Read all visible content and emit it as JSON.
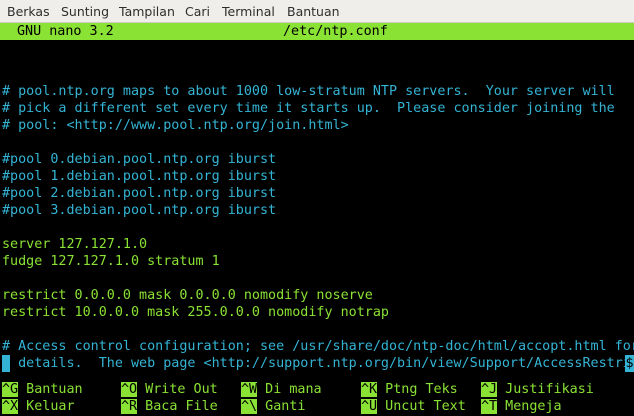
{
  "menubar": {
    "items": [
      "Berkas",
      "Sunting",
      "Tampilan",
      "Cari",
      "Terminal",
      "Bantuan"
    ]
  },
  "nano": {
    "version": "GNU nano 3.2",
    "filename": "/etc/ntp.conf"
  },
  "file_lines": [
    "",
    "",
    "# pool.ntp.org maps to about 1000 low-stratum NTP servers.  Your server will",
    "# pick a different set every time it starts up.  Please consider joining the",
    "# pool: <http://www.pool.ntp.org/join.html>",
    "",
    "#pool 0.debian.pool.ntp.org iburst",
    "#pool 1.debian.pool.ntp.org iburst",
    "#pool 2.debian.pool.ntp.org iburst",
    "#pool 3.debian.pool.ntp.org iburst",
    "",
    "server 127.127.1.0",
    "fudge 127.127.1.0 stratum 1",
    "",
    "restrict 0.0.0.0 mask 0.0.0.0 nomodify noserve",
    "restrict 10.0.0.0 mask 255.0.0.0 nomodify notrap",
    "",
    "# Access control configuration; see /usr/share/doc/ntp-doc/html/accopt.html for",
    "# details.  The web page <http://support.ntp.org/bin/view/Support/AccessRestri"
  ],
  "truncation_marker": "$",
  "shortcuts": [
    {
      "key": "^G",
      "label": "Bantuan"
    },
    {
      "key": "^O",
      "label": "Write Out"
    },
    {
      "key": "^W",
      "label": "Di mana"
    },
    {
      "key": "^K",
      "label": "Ptng Teks"
    },
    {
      "key": "^J",
      "label": "Justifikasi"
    },
    {
      "key": "^X",
      "label": "Keluar"
    },
    {
      "key": "^R",
      "label": "Baca File"
    },
    {
      "key": "^\\",
      "label": "Ganti"
    },
    {
      "key": "^U",
      "label": "Uncut Text"
    },
    {
      "key": "^T",
      "label": "Mengeja"
    }
  ],
  "colors": {
    "terminal_bg": "#000000",
    "green": "#8ae234",
    "comment_cyan": "#34b4d4",
    "menubar_bg": "#f0eeea"
  }
}
